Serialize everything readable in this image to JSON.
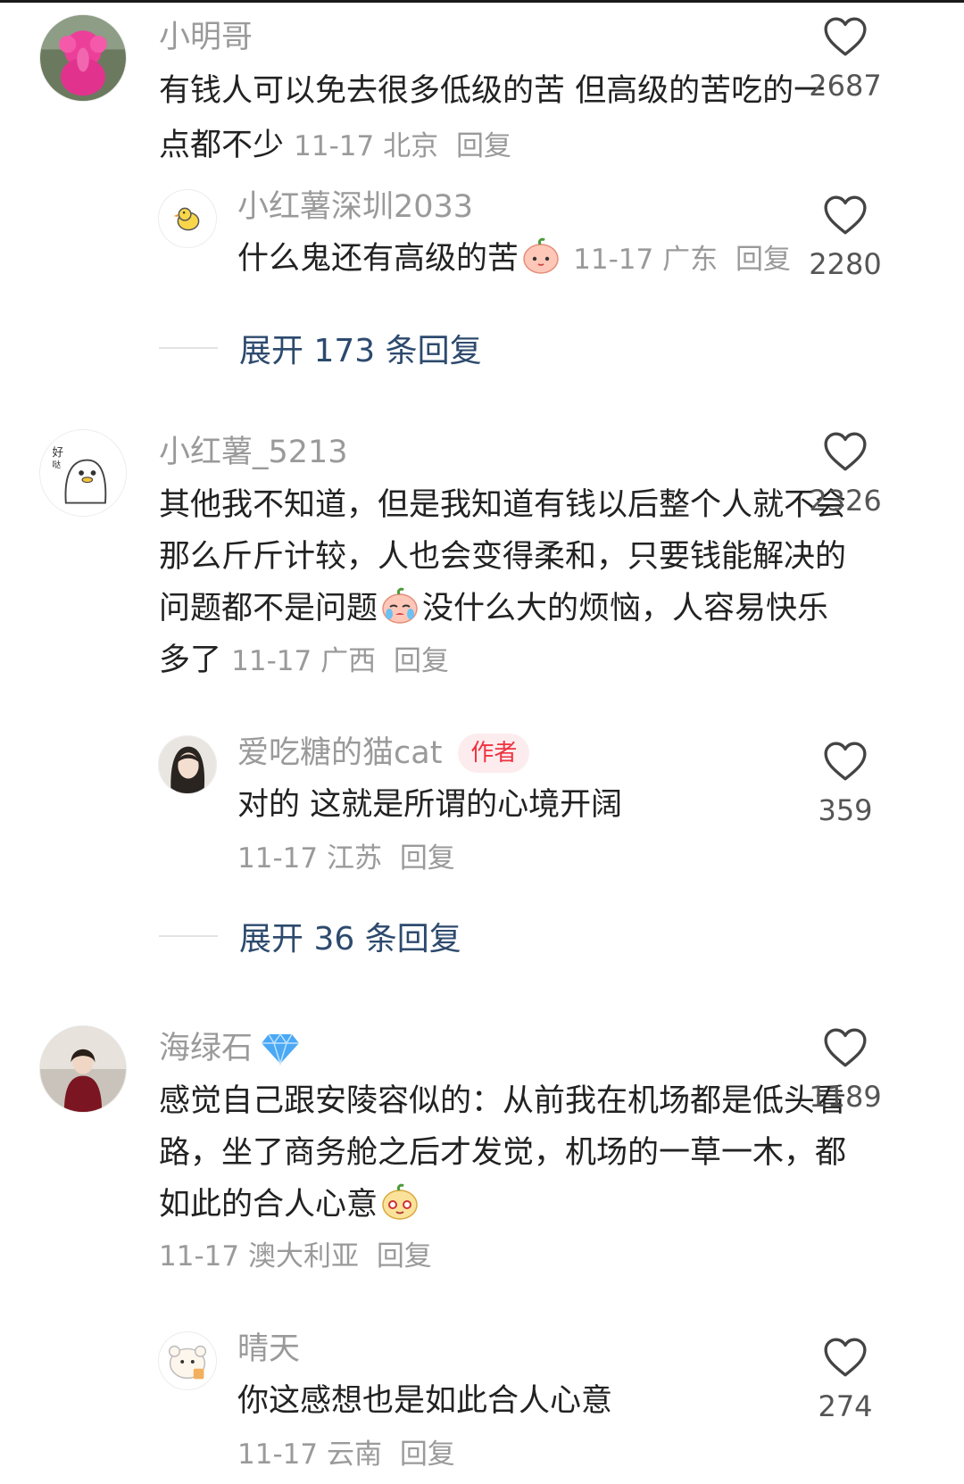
{
  "threads": [
    {
      "main": {
        "username": "小明哥",
        "text": "有钱人可以免去很多低级的苦 但高级的苦吃的一点都不少",
        "date": "11-17",
        "location": "北京",
        "reply_label": "回复",
        "likes": "2687"
      },
      "sub": {
        "username": "小红薯深圳2033",
        "text": "什么鬼还有高级的苦",
        "date": "11-17",
        "location": "广东",
        "reply_label": "回复",
        "likes": "2280"
      },
      "expand_label": "展开 173 条回复"
    },
    {
      "main": {
        "username": "小红薯_5213",
        "text_before_emoji": "其他我不知道，但是我知道有钱以后整个人就不会那么斤斤计较，人也会变得柔和，只要钱能解决的问题都不是问题",
        "text_after_emoji": "没什么大的烦恼，人容易快乐多了",
        "date": "11-17",
        "location": "广西",
        "reply_label": "回复",
        "likes": "2326"
      },
      "sub": {
        "username": "爱吃糖的猫cat",
        "badge": "作者",
        "text": "对的 这就是所谓的心境开阔",
        "date": "11-17",
        "location": "江苏",
        "reply_label": "回复",
        "likes": "359"
      },
      "expand_label": "展开 36 条回复"
    },
    {
      "main": {
        "username": "海绿石",
        "text": "感觉自己跟安陵容似的：从前我在机场都是低头看路，坐了商务舱之后才发觉，机场的一草一木，都如此的合人心意",
        "date": "11-17",
        "location": "澳大利亚",
        "reply_label": "回复",
        "likes": "1189"
      },
      "sub": {
        "username": "晴天",
        "text": "你这感想也是如此合人心意",
        "date": "11-17",
        "location": "云南",
        "reply_label": "回复",
        "likes": "274"
      }
    }
  ],
  "icons": {
    "heart": "heart-outline-icon",
    "verified": "diamond-icon"
  },
  "colors": {
    "username": "#9a9a9a",
    "body": "#222222",
    "expand_link": "#2d4a6e",
    "author_badge_text": "#f0313f",
    "author_badge_bg": "#fdecee",
    "diamond": "#4aa8f5"
  }
}
